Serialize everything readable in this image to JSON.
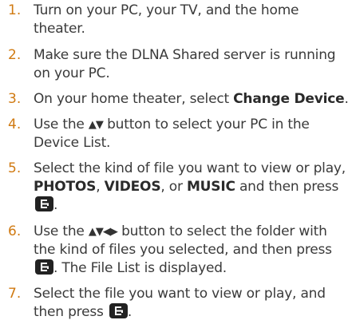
{
  "steps": [
    {
      "number": "1.",
      "text": "Turn on your PC, your TV, and the home theater."
    },
    {
      "number": "2.",
      "text": "Make sure the DLNA Shared server is running on your PC."
    },
    {
      "number": "3.",
      "text_before": "On your home theater, select ",
      "bold": "Change Device",
      "text_after": "."
    },
    {
      "number": "4.",
      "text_before": "Use the ",
      "arrows": "▲▼",
      "text_after": " button to select your PC in the Device List."
    },
    {
      "number": "5.",
      "text_before": "Select the kind of file you want to view or play, ",
      "bold1": "PHOTOS",
      "sep1": ", ",
      "bold2": "VIDEOS",
      "sep2": ", or ",
      "bold3": "MUSIC",
      "text_after": " and then press ",
      "end": "."
    },
    {
      "number": "6.",
      "text_before": "Use the ",
      "arrows": "▲▼◀▶",
      "text_after": " button to select the folder with the kind of files you selected, and then press ",
      "end": ". The File List is displayed."
    },
    {
      "number": "7.",
      "text_before": "Select the file you want to view or play, and then press ",
      "end": "."
    }
  ],
  "icons": {
    "enter": "enter-icon",
    "enter_color": "#222222"
  },
  "colors": {
    "step_number": "#d07a12",
    "body_text": "#3a3a3a"
  }
}
